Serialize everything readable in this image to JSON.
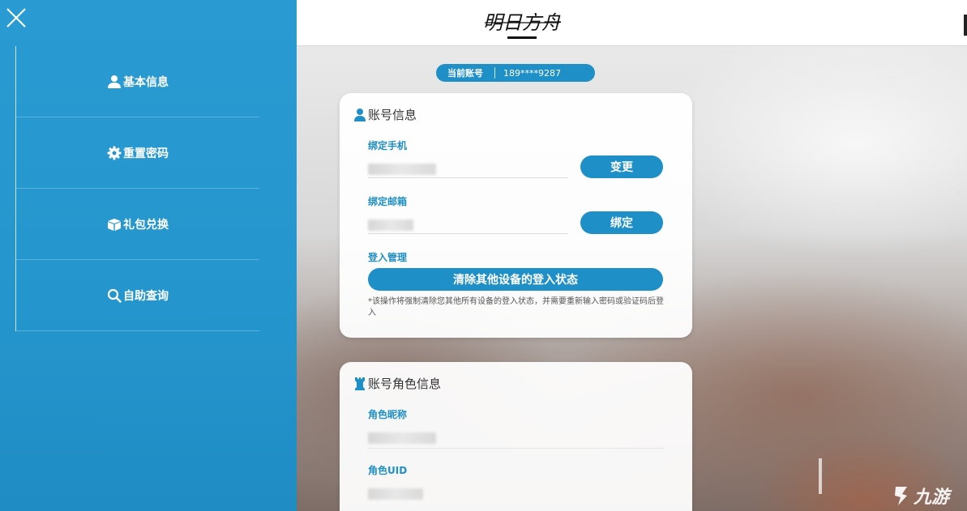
{
  "header": {
    "logo_text": "明日方舟"
  },
  "sidebar": {
    "items": [
      {
        "label": "基本信息",
        "icon": "user-icon"
      },
      {
        "label": "重置密码",
        "icon": "gear-icon"
      },
      {
        "label": "礼包兑换",
        "icon": "gift-box-icon"
      },
      {
        "label": "自助查询",
        "icon": "search-icon"
      }
    ]
  },
  "account": {
    "label": "当前账号",
    "value": "189****9287"
  },
  "account_info": {
    "title": "账号信息",
    "phone_label": "绑定手机",
    "phone_button": "变更",
    "email_label": "绑定邮箱",
    "email_button": "绑定",
    "login_label": "登入管理",
    "clear_button": "清除其他设备的登入状态",
    "note": "*该操作将强制清除您其他所有设备的登入状态，并需要重新输入密码或验证码后登入"
  },
  "role_info": {
    "title": "账号角色信息",
    "nickname_label": "角色昵称",
    "uid_label": "角色UID"
  },
  "watermark": {
    "text": "九游",
    "icon": "jiuyou-logo-icon"
  },
  "colors": {
    "accent": "#1f8fc8",
    "sidebar": "#2596cd"
  }
}
